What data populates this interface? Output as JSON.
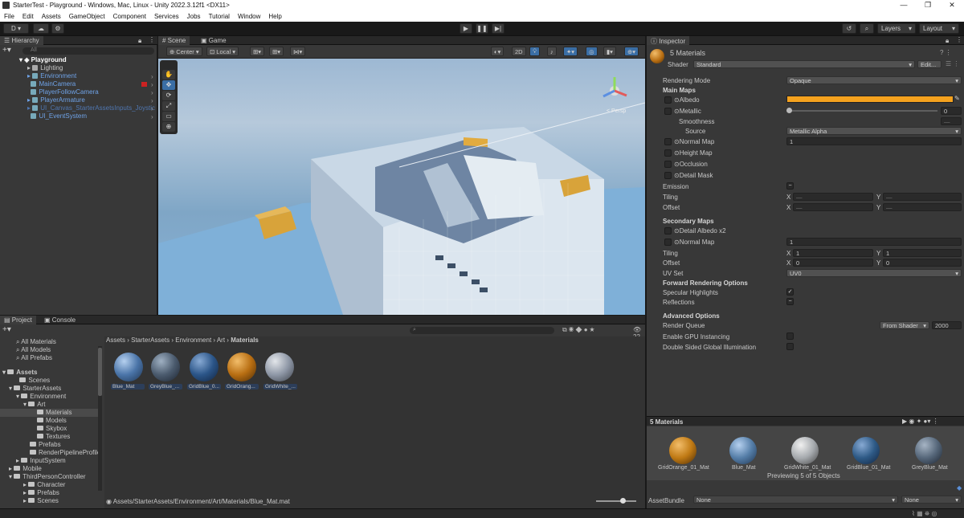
{
  "titlebar": {
    "title": "StarterTest - Playground - Windows, Mac, Linux - Unity 2022.3.12f1 <DX11>",
    "min": "—",
    "max": "❐",
    "close": "✕"
  },
  "menu": [
    "File",
    "Edit",
    "Assets",
    "GameObject",
    "Component",
    "Services",
    "Jobs",
    "Tutorial",
    "Window",
    "Help"
  ],
  "toolbar": {
    "account": "D",
    "layers": "Layers",
    "layout": "Layout",
    "play": "▶",
    "pause": "❚❚",
    "step": "▶|"
  },
  "hierarchy": {
    "tab": "Hierarchy",
    "search_placeholder": "All",
    "scene": "Playground",
    "items": [
      {
        "label": "Lighting",
        "blue": false,
        "indent": 1
      },
      {
        "label": "Environment",
        "blue": true,
        "indent": 1
      },
      {
        "label": "MainCamera",
        "blue": true,
        "indent": 1
      },
      {
        "label": "PlayerFollowCamera",
        "blue": true,
        "indent": 1
      },
      {
        "label": "PlayerArmature",
        "blue": true,
        "indent": 1
      },
      {
        "label": "UI_Canvas_StarterAssetsInputs_Joystic",
        "blue": true,
        "indent": 1
      },
      {
        "label": "UI_EventSystem",
        "blue": true,
        "indent": 1
      }
    ]
  },
  "scene": {
    "tab_scene": "Scene",
    "tab_game": "Game",
    "center": "Center",
    "local": "Local",
    "mode2d": "2D",
    "persp": "< Persp",
    "tools": [
      "✋",
      "✥",
      "⟳",
      "⤢",
      "▭",
      "⊕"
    ]
  },
  "project": {
    "tab_project": "Project",
    "tab_console": "Console",
    "count": "22",
    "favorites": [
      "All Materials",
      "All Models",
      "All Prefabs"
    ],
    "tree": [
      {
        "label": "Assets",
        "indent": 0,
        "bold": true
      },
      {
        "label": "Scenes",
        "indent": 2
      },
      {
        "label": "StarterAssets",
        "indent": 1
      },
      {
        "label": "Environment",
        "indent": 2
      },
      {
        "label": "Art",
        "indent": 3
      },
      {
        "label": "Materials",
        "indent": 4,
        "selected": true
      },
      {
        "label": "Models",
        "indent": 4
      },
      {
        "label": "Skybox",
        "indent": 4
      },
      {
        "label": "Textures",
        "indent": 4
      },
      {
        "label": "Prefabs",
        "indent": 3
      },
      {
        "label": "RenderPipelineProfile",
        "indent": 3
      },
      {
        "label": "InputSystem",
        "indent": 2
      },
      {
        "label": "Mobile",
        "indent": 1
      },
      {
        "label": "ThirdPersonController",
        "indent": 1
      },
      {
        "label": "Character",
        "indent": 2
      },
      {
        "label": "Prefabs",
        "indent": 2
      },
      {
        "label": "Scenes",
        "indent": 2
      }
    ],
    "breadcrumb": [
      "Assets",
      "StarterAssets",
      "Environment",
      "Art",
      "Materials"
    ],
    "materials": [
      {
        "label": "Blue_Mat",
        "color": "#4a74a8"
      },
      {
        "label": "GreyBlue_...",
        "color": "#4b5b6e"
      },
      {
        "label": "GridBlue_0...",
        "color": "#2b5588"
      },
      {
        "label": "GridOrang...",
        "color": "#b86e12"
      },
      {
        "label": "GridWhite_...",
        "color": "#8e97a6"
      }
    ],
    "path": "Assets/StarterAssets/Environment/Art/Materials/Blue_Mat.mat"
  },
  "inspector": {
    "tab": "Inspector",
    "title": "5 Materials",
    "shader_label": "Shader",
    "shader": "Standard",
    "edit": "Edit...",
    "rendering_mode_label": "Rendering Mode",
    "rendering_mode": "Opaque",
    "main_maps": "Main Maps",
    "albedo": "Albedo",
    "albedo_color": "#f5a21e",
    "metallic": "Metallic",
    "metallic_value": "0",
    "smoothness": "Smoothness",
    "source": "Source",
    "source_value": "Metallic Alpha",
    "normal_map": "Normal Map",
    "normal_value": "1",
    "height_map": "Height Map",
    "occlusion": "Occlusion",
    "detail_mask": "Detail Mask",
    "emission": "Emission",
    "tiling": "Tiling",
    "offset": "Offset",
    "x": "X",
    "y": "Y",
    "dash": "—",
    "secondary": "Secondary Maps",
    "detail_albedo": "Detail Albedo x2",
    "sec_normal": "Normal Map",
    "sec_normal_value": "1",
    "sec_tiling_x": "1",
    "sec_tiling_y": "1",
    "sec_offset_x": "0",
    "sec_offset_y": "0",
    "uv_set": "UV Set",
    "uv_value": "UV0",
    "forward": "Forward Rendering Options",
    "specular": "Specular Highlights",
    "reflections": "Reflections",
    "advanced": "Advanced Options",
    "render_queue": "Render Queue",
    "render_queue_mode": "From Shader",
    "render_queue_value": "2000",
    "gpu": "Enable GPU Instancing",
    "double_sided": "Double Sided Global Illumination",
    "preview_title": "5 Materials",
    "previews": [
      {
        "label": "GridOrange_01_Mat",
        "color": "#c07a14"
      },
      {
        "label": "Blue_Mat",
        "color": "#557ea8"
      },
      {
        "label": "GridWhite_01_Mat",
        "color": "#a6aaae"
      },
      {
        "label": "GridBlue_01_Mat",
        "color": "#2e5a86"
      },
      {
        "label": "GreyBlue_Mat",
        "color": "#56677a"
      }
    ],
    "previewing": "Previewing 5 of 5 Objects",
    "asset_bundle": "AssetBundle",
    "none1": "None",
    "none2": "None"
  }
}
